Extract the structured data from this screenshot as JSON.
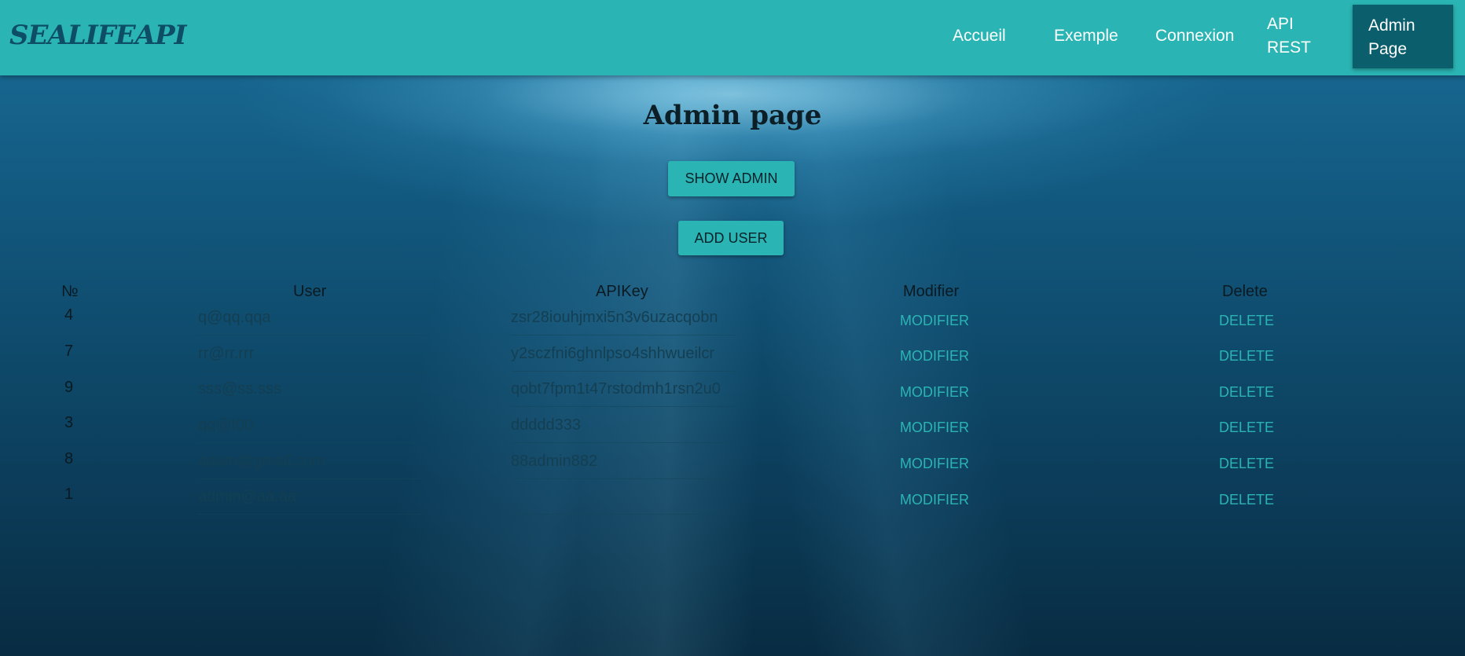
{
  "navbar": {
    "brand": "SEALIFEAPI",
    "links": [
      "Accueil",
      "Exemple",
      "Connexion",
      "API REST"
    ],
    "active": "Admin Page"
  },
  "page": {
    "title": "Admin page",
    "show_admin_label": "SHOW ADMIN",
    "add_user_label": "ADD USER"
  },
  "table": {
    "headers": [
      "№",
      "User",
      "APIKey",
      "Modifier",
      "Delete"
    ],
    "modify_label": "MODIFIER",
    "delete_label": "DELETE",
    "rows": [
      {
        "id": "4",
        "user": "q@qq.qqa",
        "apikey": "zsr28iouhjmxi5n3v6uzacqobn"
      },
      {
        "id": "7",
        "user": "rr@rr.rrr",
        "apikey": "y2sczfni6ghnlpso4shhwueilcr"
      },
      {
        "id": "9",
        "user": "sss@ss.sss",
        "apikey": "qobt7fpm1t47rstodmh1rsn2u0"
      },
      {
        "id": "3",
        "user": "qq@t00",
        "apikey": "ddddd333"
      },
      {
        "id": "8",
        "user": "adam@gmail.com",
        "apikey": "88admin882"
      },
      {
        "id": "1",
        "user": "admin@aa.aa",
        "apikey": ""
      }
    ]
  },
  "colors": {
    "accent": "#2ab5b4",
    "active_nav": "#0b5e6c",
    "brand_text": "#0e4e64"
  }
}
